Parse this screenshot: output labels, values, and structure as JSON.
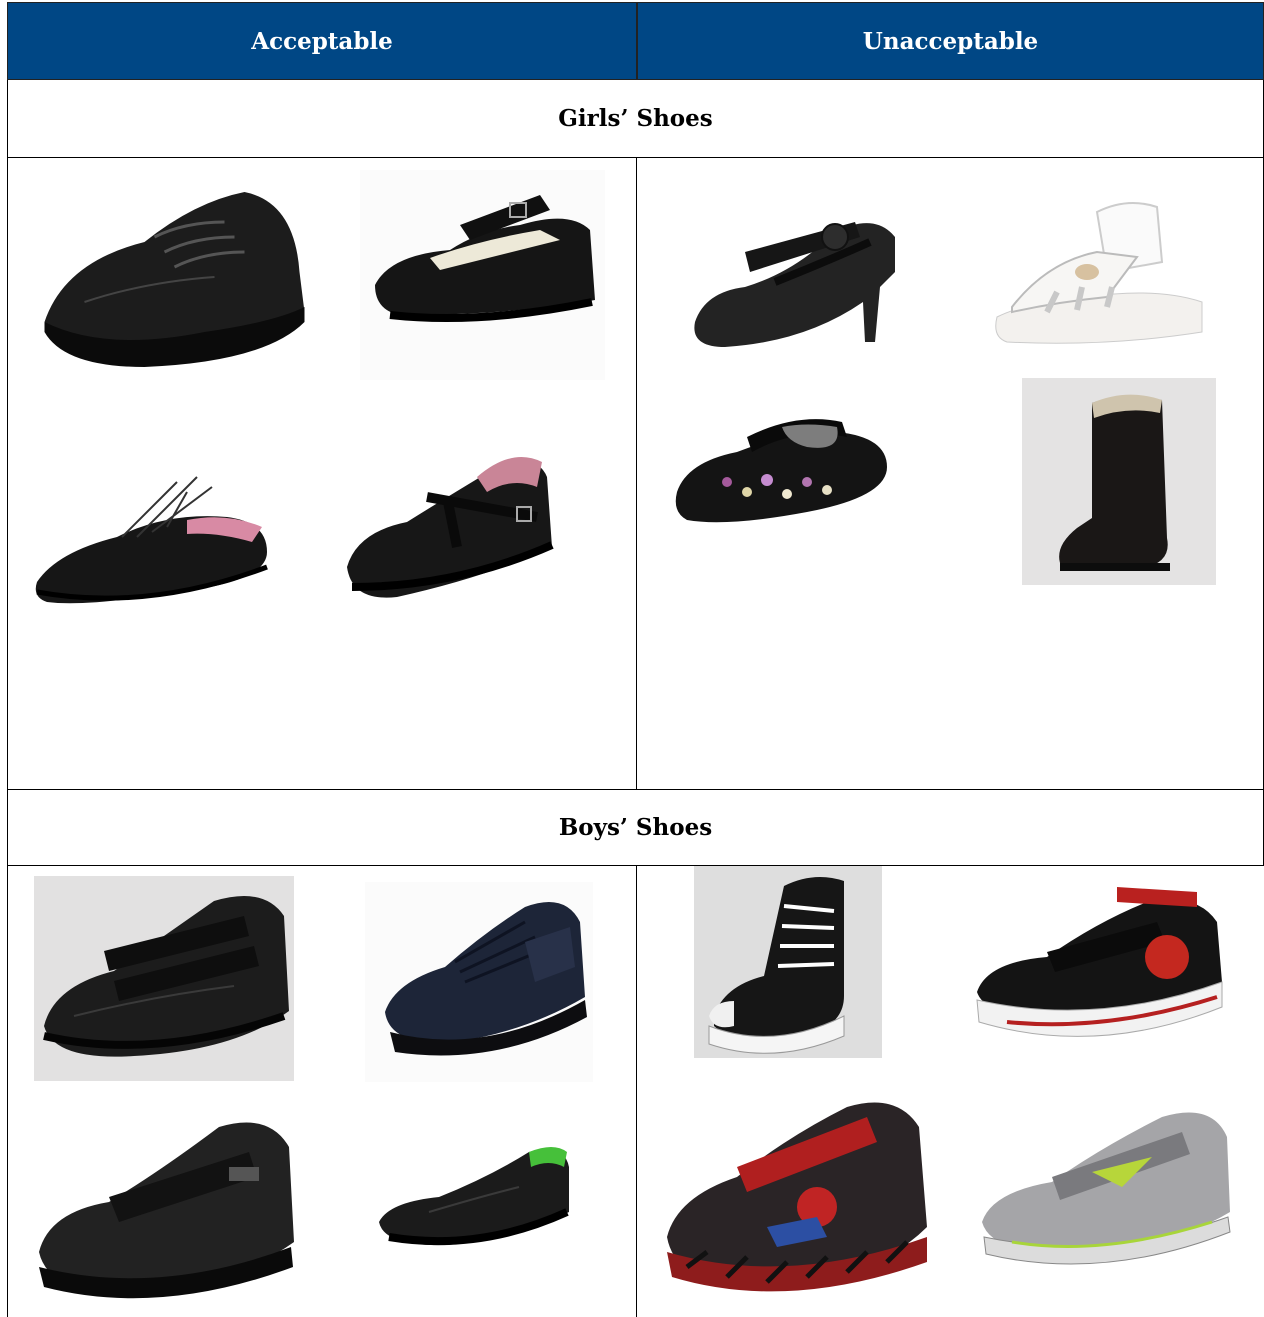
{
  "table": {
    "col_left": "Acceptable",
    "col_right": "Unacceptable",
    "section_girls": "Girls’ Shoes",
    "section_boys": "Boys’ Shoes"
  },
  "colors": {
    "header_bg": "#004785",
    "header_text": "#ffffff",
    "border": "#000000"
  },
  "images": {
    "girls_acceptable": [
      "black-lace-up-school-shoe",
      "black-mary-jane-shoe",
      "black-oxford-flat",
      "black-t-bar-shoe"
    ],
    "girls_unacceptable": [
      "heeled-mary-jane",
      "white-sandal",
      "embroidered-canvas-shoe",
      "suede-boot"
    ],
    "boys_acceptable": [
      "black-velcro-trainer-shoe",
      "navy-lace-up-shoe",
      "black-velcro-shoe",
      "black-slip-on-loafer"
    ],
    "boys_unacceptable": [
      "black-hi-top-sneaker",
      "spider-canvas-sneaker",
      "light-up-trainer",
      "silver-velcro-trainer"
    ]
  }
}
